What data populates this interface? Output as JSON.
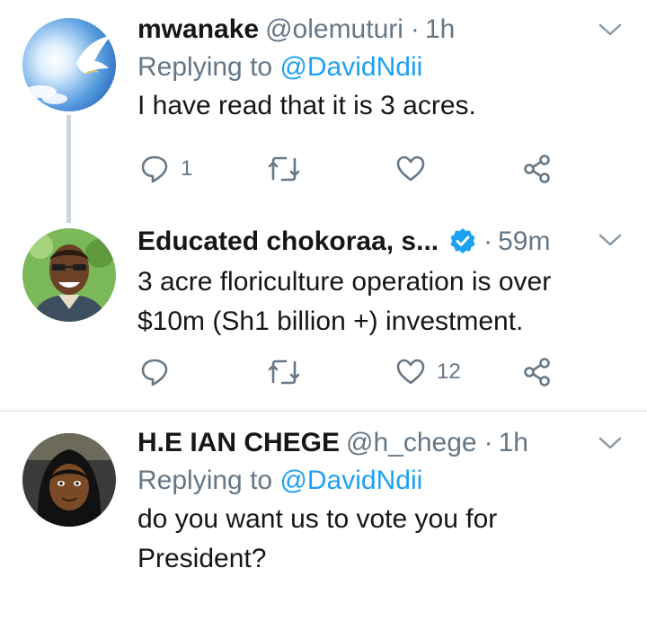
{
  "tweets": [
    {
      "name": "mwanake",
      "handle": "@olemuturi",
      "dot": "·",
      "time": "1h",
      "replying_prefix": "Replying to ",
      "replying_to": "@DavidNdii",
      "text": "I have read that it is 3 acres.",
      "reply_count": "1",
      "retweet_count": "",
      "like_count": ""
    },
    {
      "name": "Educated chokoraa, s...",
      "handle": "",
      "dot": "·",
      "time": "59m",
      "text": "3 acre floriculture operation is over $10m (Sh1 billion +) investment.",
      "reply_count": "",
      "retweet_count": "",
      "like_count": "12"
    },
    {
      "name": "H.E IAN CHEGE",
      "handle": "@h_chege",
      "dot": "·",
      "time": "1h",
      "replying_prefix": "Replying to ",
      "replying_to": "@DavidNdii",
      "text": "do you want us to vote you for President?"
    }
  ],
  "colors": {
    "secondary_text": "#657786",
    "link": "#1da1f2",
    "verified": "#1da1f2",
    "thread_line": "#cdd6dd",
    "separator": "#e6ecf0"
  },
  "icons": [
    "reply-icon",
    "retweet-icon",
    "like-icon",
    "share-icon",
    "chevron-down-icon",
    "verified-badge-icon"
  ]
}
